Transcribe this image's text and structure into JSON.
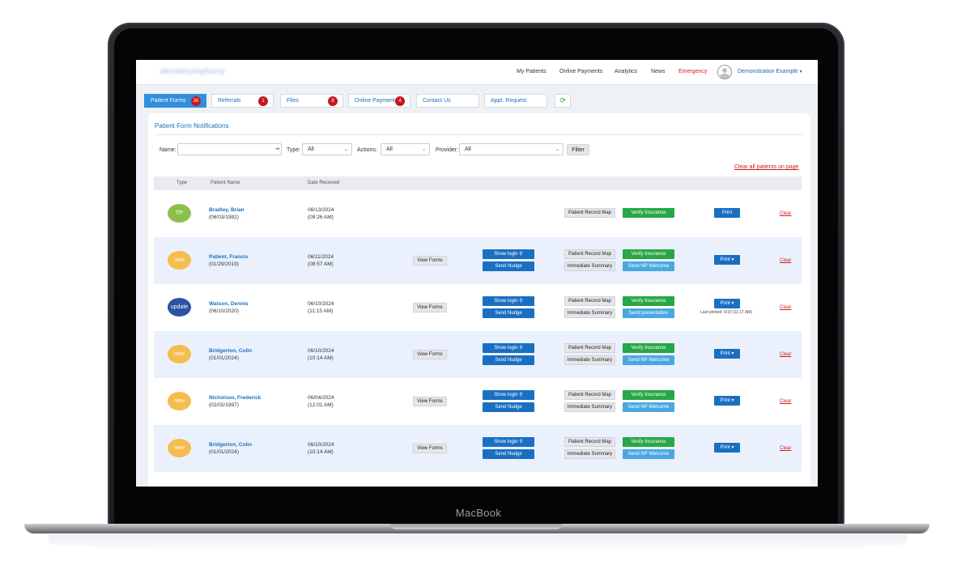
{
  "device": {
    "brand": "MacBook"
  },
  "nav": {
    "logo": "dentalsymphony",
    "links": [
      "My Patients",
      "Online Payments",
      "Analytics",
      "News",
      "Emergency"
    ],
    "user": "Demonstration Example"
  },
  "tabs": [
    {
      "label": "Patient Forms",
      "badge": "36"
    },
    {
      "label": "Referrals",
      "badge": "1"
    },
    {
      "label": "Files",
      "badge": "8"
    },
    {
      "label": "Online Payments",
      "badge": "4"
    },
    {
      "label": "Contact Us",
      "badge": ""
    },
    {
      "label": "Appt. Request",
      "badge": ""
    }
  ],
  "panel": {
    "title": "Patient Form Notifications",
    "filters": {
      "name_label": "Name:",
      "name_value": "",
      "type_label": "Type:",
      "type_value": "All",
      "actions_label": "Actions:",
      "actions_value": "All",
      "provider_label": "Provider:",
      "provider_value": "All",
      "filter_button": "Filter"
    },
    "clear_all": "Clear all patients on page"
  },
  "table": {
    "headers": {
      "type": "Type",
      "name": "Patient Name",
      "date": "Date Received"
    },
    "rows": [
      {
        "type": "TP",
        "type_color": "#8dc04b",
        "name": "Bradley, Brian",
        "dob": "(06/03/1982)",
        "date": "06/13/2024",
        "time": "(09:26 AM)",
        "view_forms": "",
        "show_login": "",
        "send_nudge": "",
        "record_map": "Patient Record Map",
        "immediate": "",
        "verify": "Verify Insurance",
        "welcome": "",
        "print": "Print",
        "last_printed": "",
        "clear": "Clear"
      },
      {
        "type": "new",
        "type_color": "#f5bd4f",
        "name": "Patient, Francis",
        "dob": "(01/29/2019)",
        "date": "06/11/2024",
        "time": "(08:57 AM)",
        "view_forms": "View Forms",
        "show_login": "Show login",
        "send_nudge": "Send Nudge",
        "record_map": "Patient Record Map",
        "immediate": "Immediate Summary",
        "verify": "Verify Insurance",
        "welcome": "Send NP Welcome",
        "print": "Print",
        "last_printed": "",
        "clear": "Clear"
      },
      {
        "type": "update",
        "type_color": "#2b52a3",
        "name": "Watson, Dennis",
        "dob": "(06/10/2020)",
        "date": "06/10/2024",
        "time": "(11:15 AM)",
        "view_forms": "View Forms",
        "show_login": "Show login",
        "send_nudge": "Send Nudge",
        "record_map": "Patient Record Map",
        "immediate": "Immediate Summary",
        "verify": "Verify Insurance",
        "welcome": "Send presentation",
        "print": "Print",
        "last_printed": "Last printed: 6/10 (11:17 AM)",
        "clear": "Clear"
      },
      {
        "type": "new",
        "type_color": "#f5bd4f",
        "name": "Bridgerton, Colin",
        "dob": "(01/01/2024)",
        "date": "06/10/2024",
        "time": "(10:14 AM)",
        "view_forms": "View Forms",
        "show_login": "Show login",
        "send_nudge": "Send Nudge",
        "record_map": "Patient Record Map",
        "immediate": "Immediate Summary",
        "verify": "Verify Insurance",
        "welcome": "Send NP Welcome",
        "print": "Print",
        "last_printed": "",
        "clear": "Clear"
      },
      {
        "type": "new",
        "type_color": "#f5bd4f",
        "name": "Nicholson, Frederick",
        "dob": "(02/02/1997)",
        "date": "06/04/2024",
        "time": "(12:01 AM)",
        "view_forms": "View Forms",
        "show_login": "Show login",
        "send_nudge": "Send Nudge",
        "record_map": "Patient Record Map",
        "immediate": "Immediate Summary",
        "verify": "Verify Insurance",
        "welcome": "Send NP Welcome",
        "print": "Print",
        "last_printed": "",
        "clear": "Clear"
      },
      {
        "type": "new",
        "type_color": "#f5bd4f",
        "name": "Bridgerton, Colin",
        "dob": "(01/01/2024)",
        "date": "06/10/2024",
        "time": "(10:14 AM)",
        "view_forms": "View Forms",
        "show_login": "Show login",
        "send_nudge": "Send Nudge",
        "record_map": "Patient Record Map",
        "immediate": "Immediate Summary",
        "verify": "Verify Insurance",
        "welcome": "Send NP Welcome",
        "print": "Print",
        "last_printed": "",
        "clear": "Clear"
      }
    ]
  }
}
